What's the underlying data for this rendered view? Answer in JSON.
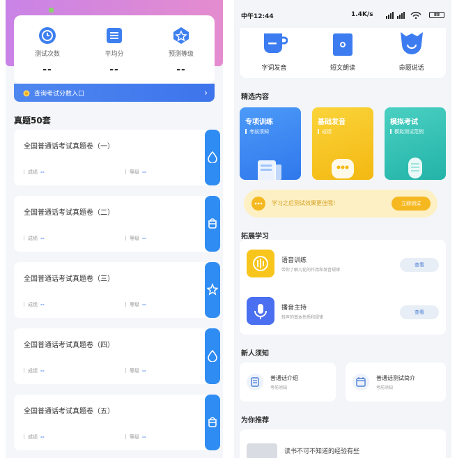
{
  "left": {
    "stats": [
      {
        "label": "测试次数",
        "value": "--",
        "icon": "clock-icon"
      },
      {
        "label": "平均分",
        "value": "--",
        "icon": "list-icon"
      },
      {
        "label": "预测等级",
        "value": "--",
        "icon": "star-icon"
      }
    ],
    "query_label": "查询考试分数入口",
    "section_title": "真题50套",
    "papers": [
      {
        "title": "全国普通话考试真题卷（一）",
        "score_label": "成绩",
        "score": "--",
        "level_label": "等级",
        "level": "--",
        "icon": "drop-icon"
      },
      {
        "title": "全国普通话考试真题卷（二）",
        "score_label": "成绩",
        "score": "--",
        "level_label": "等级",
        "level": "--",
        "icon": "bag-icon"
      },
      {
        "title": "全国普通话考试真题卷（三）",
        "score_label": "成绩",
        "score": "--",
        "level_label": "等级",
        "level": "--",
        "icon": "star-icon"
      },
      {
        "title": "全国普通话考试真题卷（四）",
        "score_label": "成绩",
        "score": "--",
        "level_label": "等级",
        "level": "--",
        "icon": "drop-icon"
      },
      {
        "title": "全国普通话考试真题卷（五）",
        "score_label": "成绩",
        "score": "--",
        "level_label": "等级",
        "level": "--",
        "icon": "bag-icon"
      }
    ]
  },
  "right": {
    "status": {
      "time": "中午12:44",
      "net": "1.4K/s",
      "battery": "88"
    },
    "top_items": [
      {
        "label": "字词发音",
        "icon": "cup-icon"
      },
      {
        "label": "短文朗读",
        "icon": "book-icon"
      },
      {
        "label": "命题说话",
        "icon": "smile-icon"
      }
    ],
    "featured_title": "精选内容",
    "featured": [
      {
        "title": "专项训练",
        "sub": "考前须知",
        "color": "#3f8ef5"
      },
      {
        "title": "基础发音",
        "sub": "成绩",
        "color": "#f8c51c"
      },
      {
        "title": "模拟考试",
        "sub": "模拟测试范例",
        "color": "#33c2b7"
      }
    ],
    "banner": {
      "text": "学习之后测试效果更佳哦！",
      "button": "立即测试"
    },
    "expand_title": "拓展学习",
    "expand": [
      {
        "title": "语音训练",
        "sub": "带你了解儿化的作用和发音规律",
        "button": "查看",
        "color": "#f8c51c"
      },
      {
        "title": "播音主持",
        "sub": "轻声的基本性质和规律",
        "button": "查看",
        "color": "#4a6ff0"
      }
    ],
    "new_title": "新人须知",
    "new_items": [
      {
        "title": "普通话介绍",
        "sub": "考前须知"
      },
      {
        "title": "普通话测试简介",
        "sub": "考前须知"
      }
    ],
    "recommend_title": "为你推荐",
    "recommend_item": "读书不可不知道的经验有些"
  }
}
